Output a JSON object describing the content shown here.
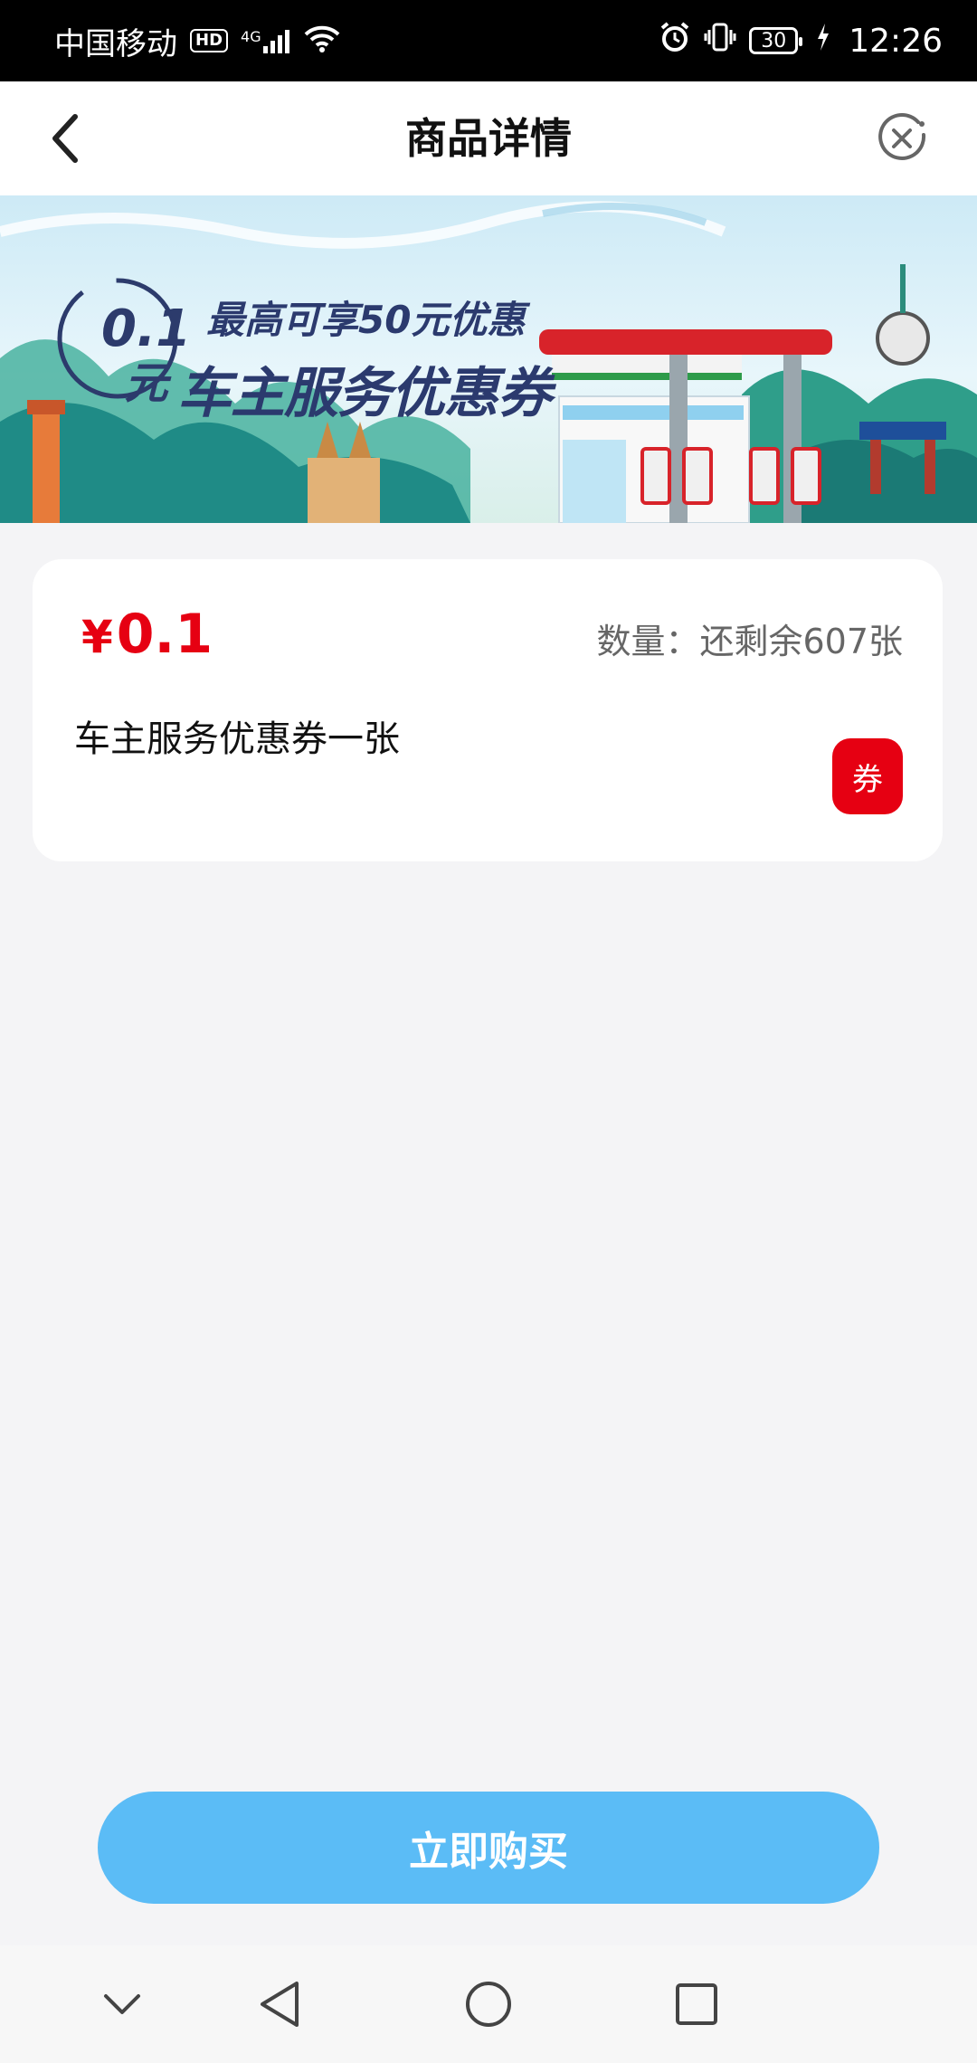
{
  "status_bar": {
    "carrier": "中国移动",
    "hd": "HD",
    "network": "4G",
    "battery": "30",
    "time": "12:26",
    "icons": [
      "hd-icon",
      "signal-icon",
      "wifi-icon",
      "alarm-icon",
      "vibrate-icon",
      "battery-icon",
      "charging-icon"
    ]
  },
  "header": {
    "title": "商品详情",
    "back_icon": "chevron-left-icon",
    "close_icon": "close-circle-icon"
  },
  "banner": {
    "stamp_value": "0.1",
    "stamp_unit": "元",
    "line1": "最高可享50元优惠",
    "line2": "车主服务优惠券"
  },
  "product": {
    "currency": "¥",
    "price": "0.1",
    "stock_label": "数量：还剩余607张",
    "description": "车主服务优惠券一张",
    "tag": "券"
  },
  "buy_button": {
    "label": "立即购买"
  },
  "colors": {
    "price_red": "#e60012",
    "button_blue": "#5bbcf6",
    "page_bg": "#f4f4f6",
    "title_dark": "#2b3a6e"
  },
  "nav_bar": {
    "icons": [
      "chevron-down-icon",
      "back-triangle-icon",
      "home-circle-icon",
      "recents-square-icon"
    ]
  }
}
